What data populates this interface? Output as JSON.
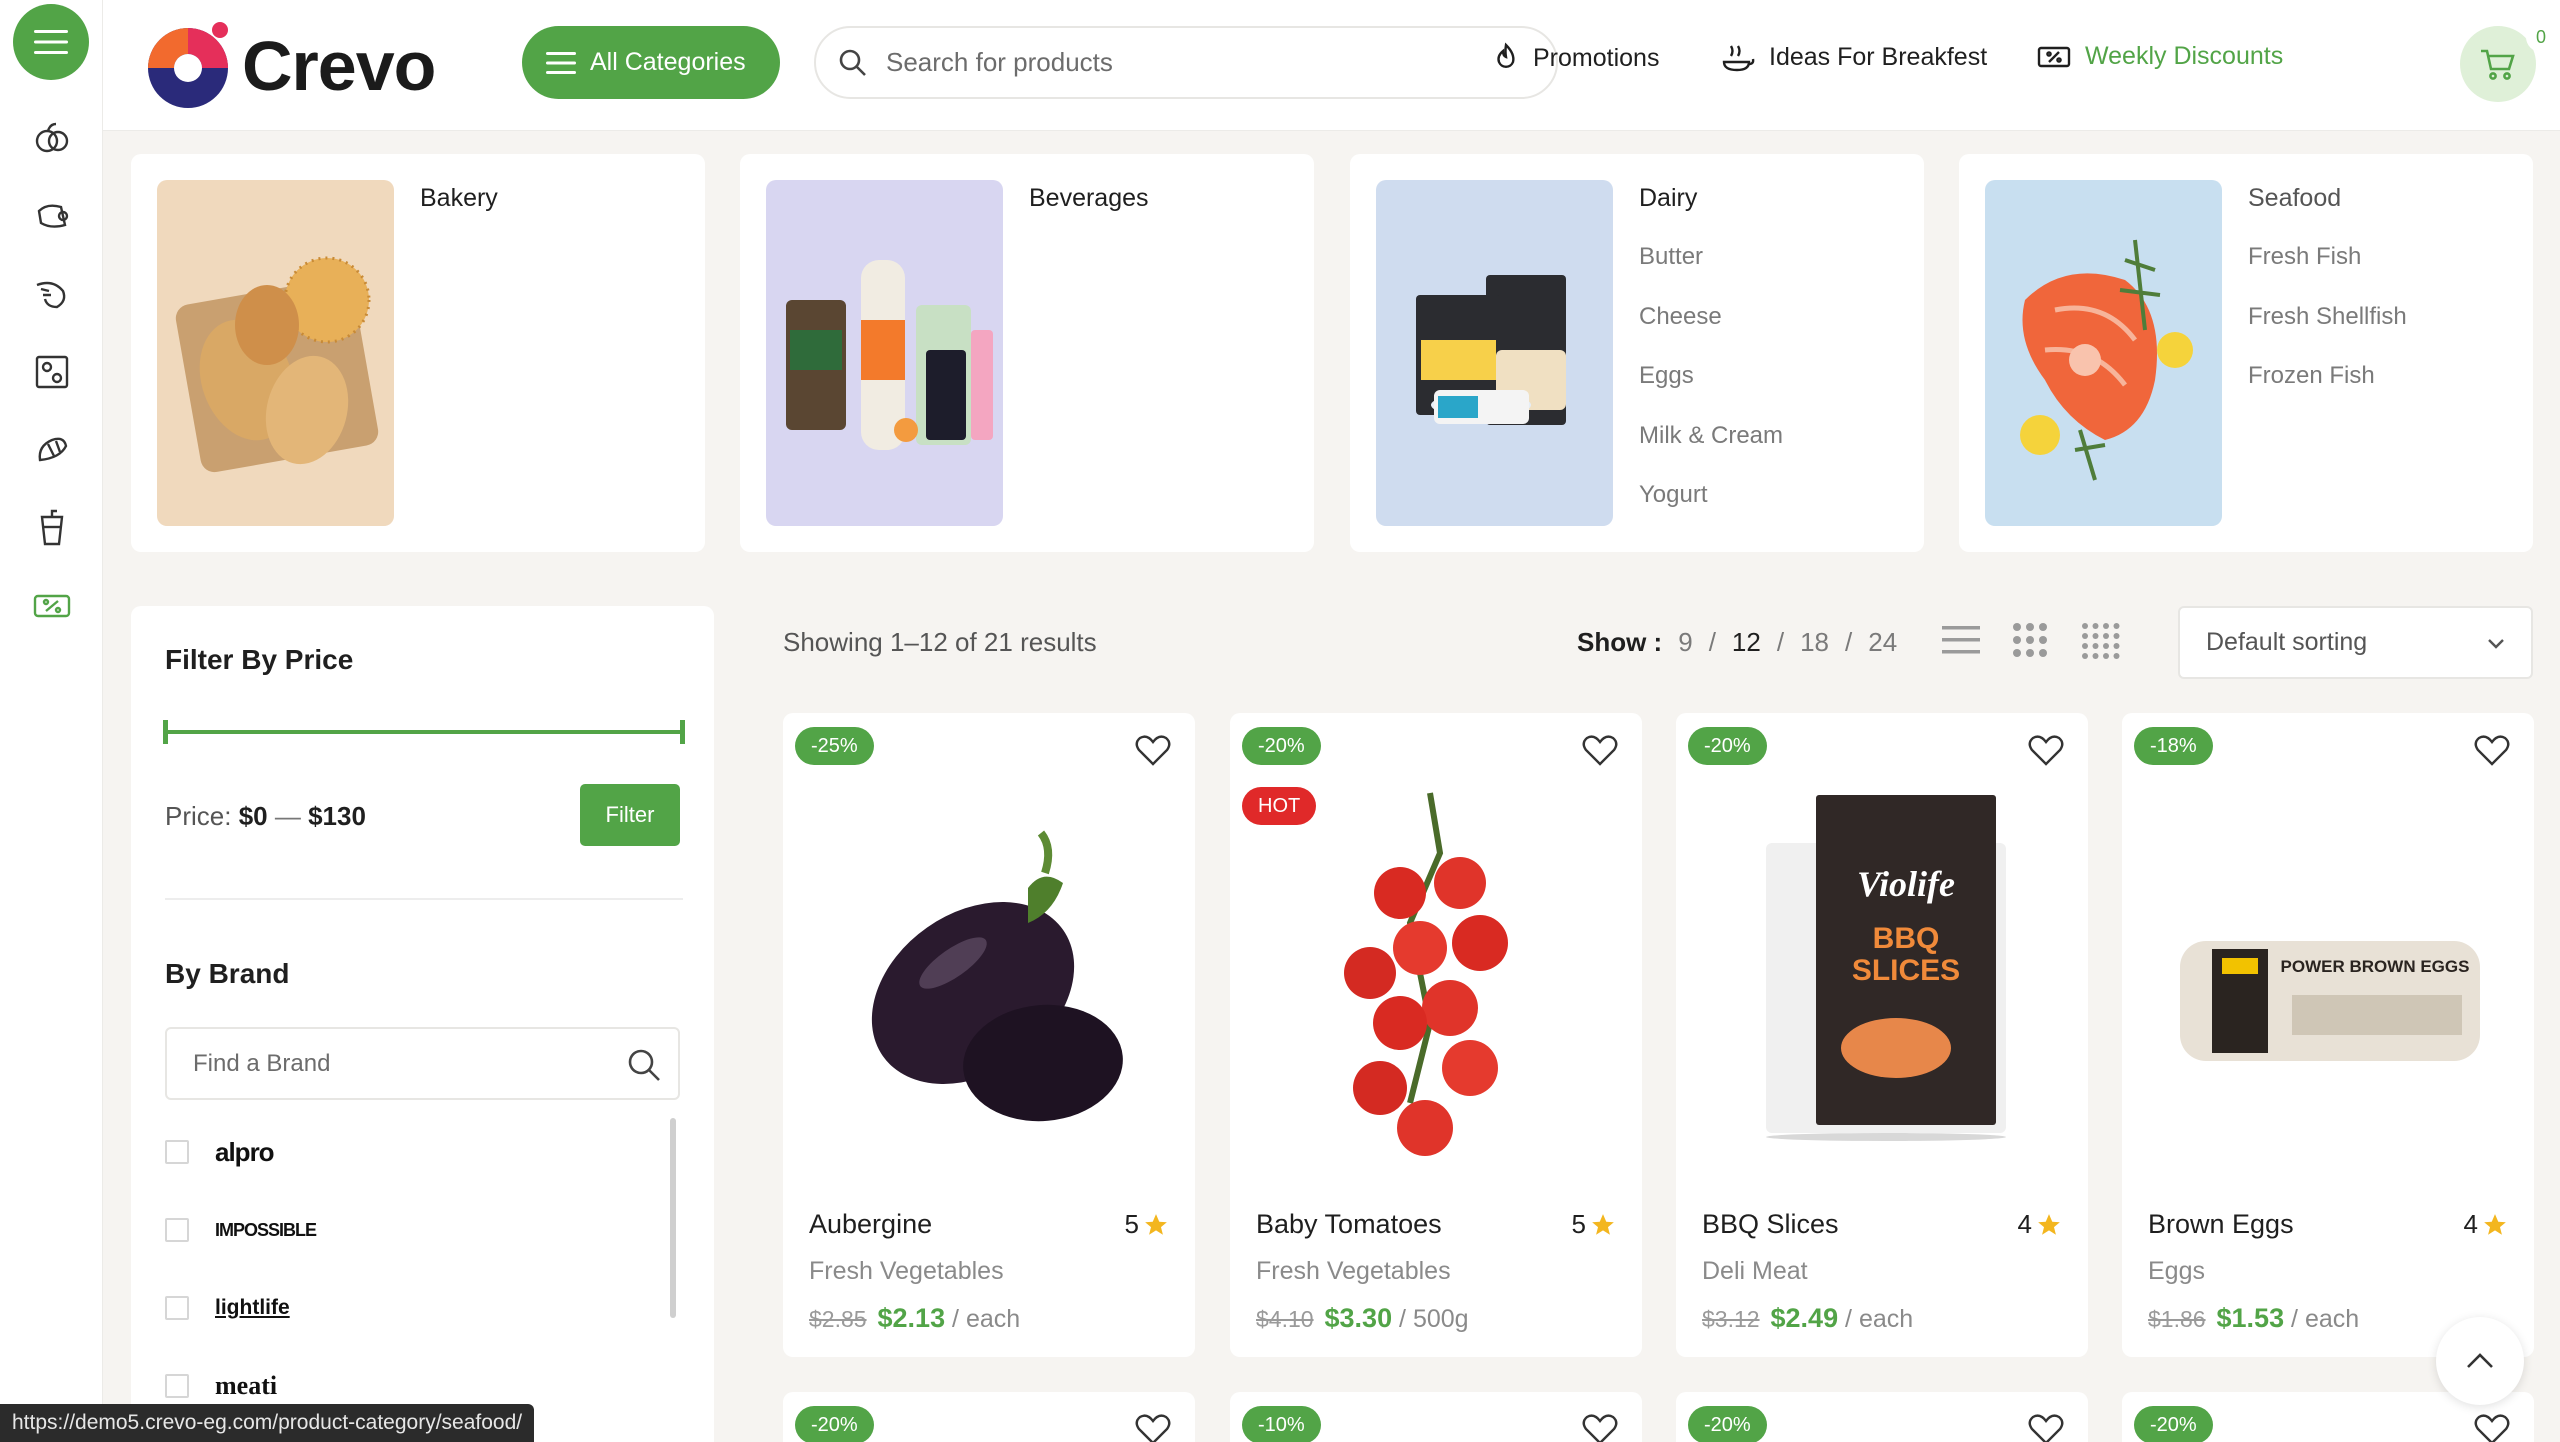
{
  "colors": {
    "accent": "#52a447",
    "hot": "#e02929",
    "cart_bg": "#dff0d8"
  },
  "brand": {
    "name": "Crevo"
  },
  "header": {
    "all_categories_label": "All Categories",
    "search_placeholder": "Search for products",
    "nav": [
      {
        "label": "Promotions",
        "icon": "fire-icon"
      },
      {
        "label": "Ideas For Breakfest",
        "icon": "breakfast-icon"
      },
      {
        "label": "Weekly Discounts",
        "icon": "ticket-icon"
      }
    ],
    "cart_count": "0"
  },
  "rail": {
    "icons": [
      "menu-icon",
      "fruit-icon",
      "meat-icon",
      "seafood-icon",
      "fridge-icon",
      "bakery-icon",
      "drink-icon",
      "discount-icon"
    ]
  },
  "categories": [
    {
      "title": "Bakery",
      "subs": []
    },
    {
      "title": "Beverages",
      "subs": []
    },
    {
      "title": "Dairy",
      "subs": [
        "Butter",
        "Cheese",
        "Eggs",
        "Milk & Cream",
        "Yogurt"
      ]
    },
    {
      "title": "Seafood",
      "subs": [
        "Fresh Fish",
        "Fresh Shellfish",
        "Frozen Fish"
      ]
    }
  ],
  "sidebar": {
    "filter_title": "Filter By Price",
    "price_prefix": "Price:",
    "price_min": "$0",
    "price_sep": "—",
    "price_max": "$130",
    "filter_button": "Filter",
    "brand_title": "By Brand",
    "brand_search_placeholder": "Find a Brand",
    "brands": [
      "alpro",
      "IMPOSSIBLE",
      "lightlife",
      "meati"
    ]
  },
  "toolbar": {
    "results": "Showing 1–12 of 21 results",
    "show_label": "Show :",
    "show_options": [
      "9",
      "12",
      "18",
      "24"
    ],
    "show_active": "12",
    "sorting": "Default sorting"
  },
  "products": [
    {
      "discount": "-25%",
      "hot": "",
      "name": "Aubergine",
      "rating": "5",
      "category": "Fresh Vegetables",
      "old_price": "$2.85",
      "price": "$2.13",
      "unit": "/ each"
    },
    {
      "discount": "-20%",
      "hot": "HOT",
      "name": "Baby Tomatoes",
      "rating": "5",
      "category": "Fresh Vegetables",
      "old_price": "$4.10",
      "price": "$3.30",
      "unit": "/ 500g"
    },
    {
      "discount": "-20%",
      "hot": "",
      "name": "BBQ Slices",
      "rating": "4",
      "category": "Deli Meat",
      "old_price": "$3.12",
      "price": "$2.49",
      "unit": "/ each"
    },
    {
      "discount": "-18%",
      "hot": "",
      "name": "Brown Eggs",
      "rating": "4",
      "category": "Eggs",
      "old_price": "$1.86",
      "price": "$1.53",
      "unit": "/ each"
    }
  ],
  "products_row2": [
    {
      "discount": "-20%"
    },
    {
      "discount": "-10%"
    },
    {
      "discount": "-20%"
    },
    {
      "discount": "-20%"
    }
  ],
  "product_images": {
    "bbq_pack_text": "BBQ SLICES",
    "bbq_pack_brand": "Violife",
    "eggs_pack_text": "POWER BROWN EGGS"
  },
  "status_url": "https://demo5.crevo-eg.com/product-category/seafood/"
}
